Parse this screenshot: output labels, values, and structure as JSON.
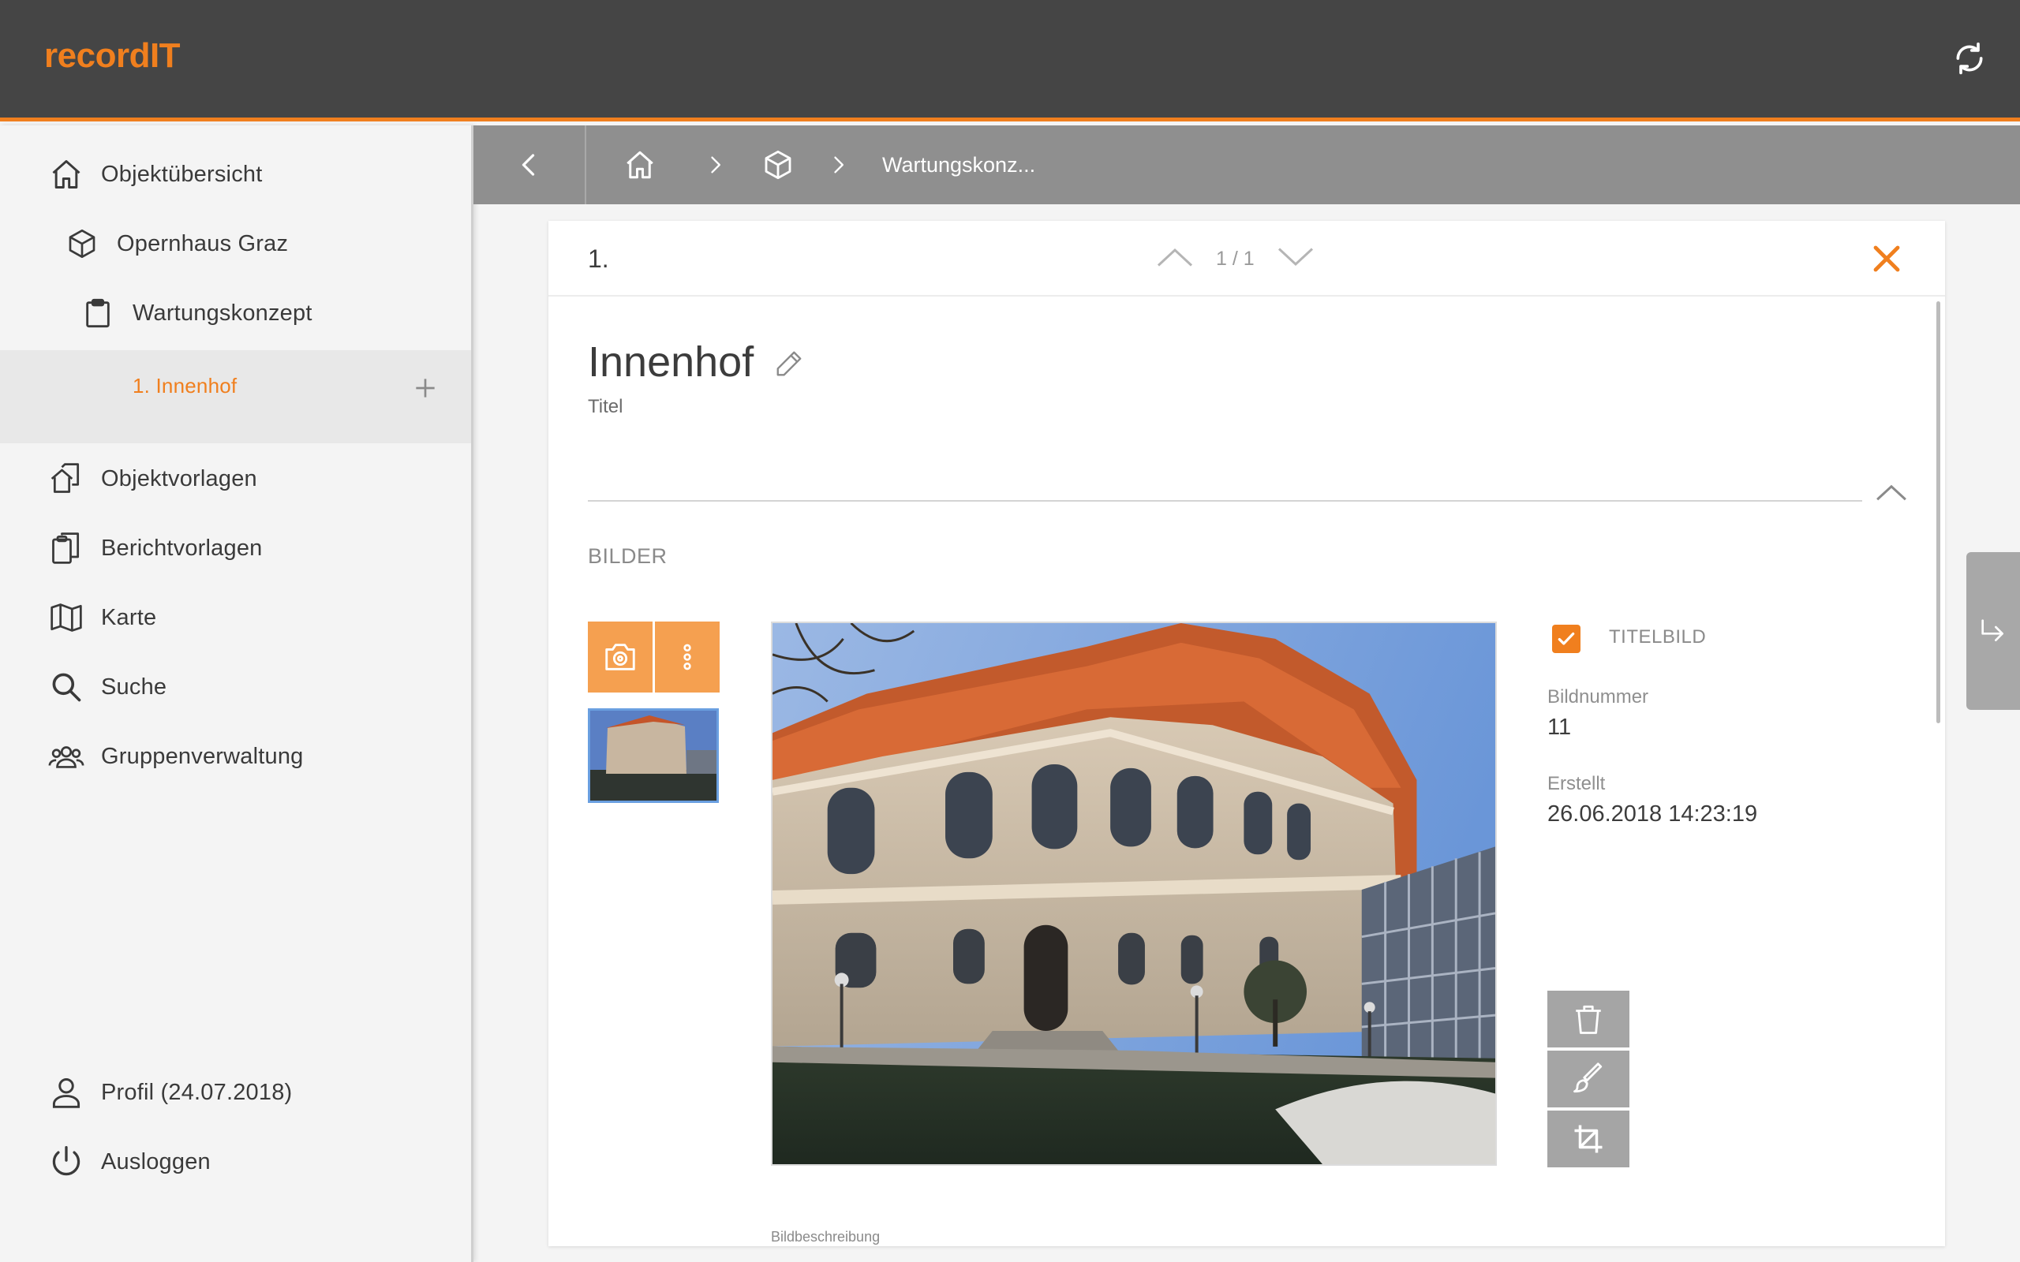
{
  "app": {
    "logo": "recordIT"
  },
  "sidebar": {
    "items": [
      {
        "label": "Objektübersicht",
        "icon": "home-icon"
      },
      {
        "label": "Opernhaus Graz",
        "icon": "cube-icon"
      },
      {
        "label": "Wartungskonzept",
        "icon": "clipboard-icon"
      },
      {
        "label": "1. Innenhof",
        "icon": "plus-icon"
      },
      {
        "label": "Objektvorlagen",
        "icon": "object-templates-icon"
      },
      {
        "label": "Berichtvorlagen",
        "icon": "report-templates-icon"
      },
      {
        "label": "Karte",
        "icon": "map-icon"
      },
      {
        "label": "Suche",
        "icon": "search-icon"
      },
      {
        "label": "Gruppenverwaltung",
        "icon": "group-icon"
      }
    ],
    "footer": [
      {
        "label": "Profil (24.07.2018)",
        "icon": "user-icon"
      },
      {
        "label": "Ausloggen",
        "icon": "power-icon"
      }
    ]
  },
  "breadcrumb": {
    "current": "Wartungskonz..."
  },
  "card": {
    "number": "1.",
    "pager": "1 / 1",
    "title": "Innenhof",
    "title_label": "Titel",
    "section": "BILDER",
    "cover_checkbox": {
      "label": "TITELBILD",
      "checked": true
    },
    "image_number": {
      "label": "Bildnummer",
      "value": "11"
    },
    "created": {
      "label": "Erstellt",
      "value": "26.06.2018 14:23:19"
    },
    "description_label": "Bildbeschreibung"
  },
  "colors": {
    "accent": "#f07f1e",
    "topbar": "#454545",
    "crumbbar": "#8f8f8f",
    "button_light": "#f5a050",
    "tool_button": "#a5a5a5"
  }
}
